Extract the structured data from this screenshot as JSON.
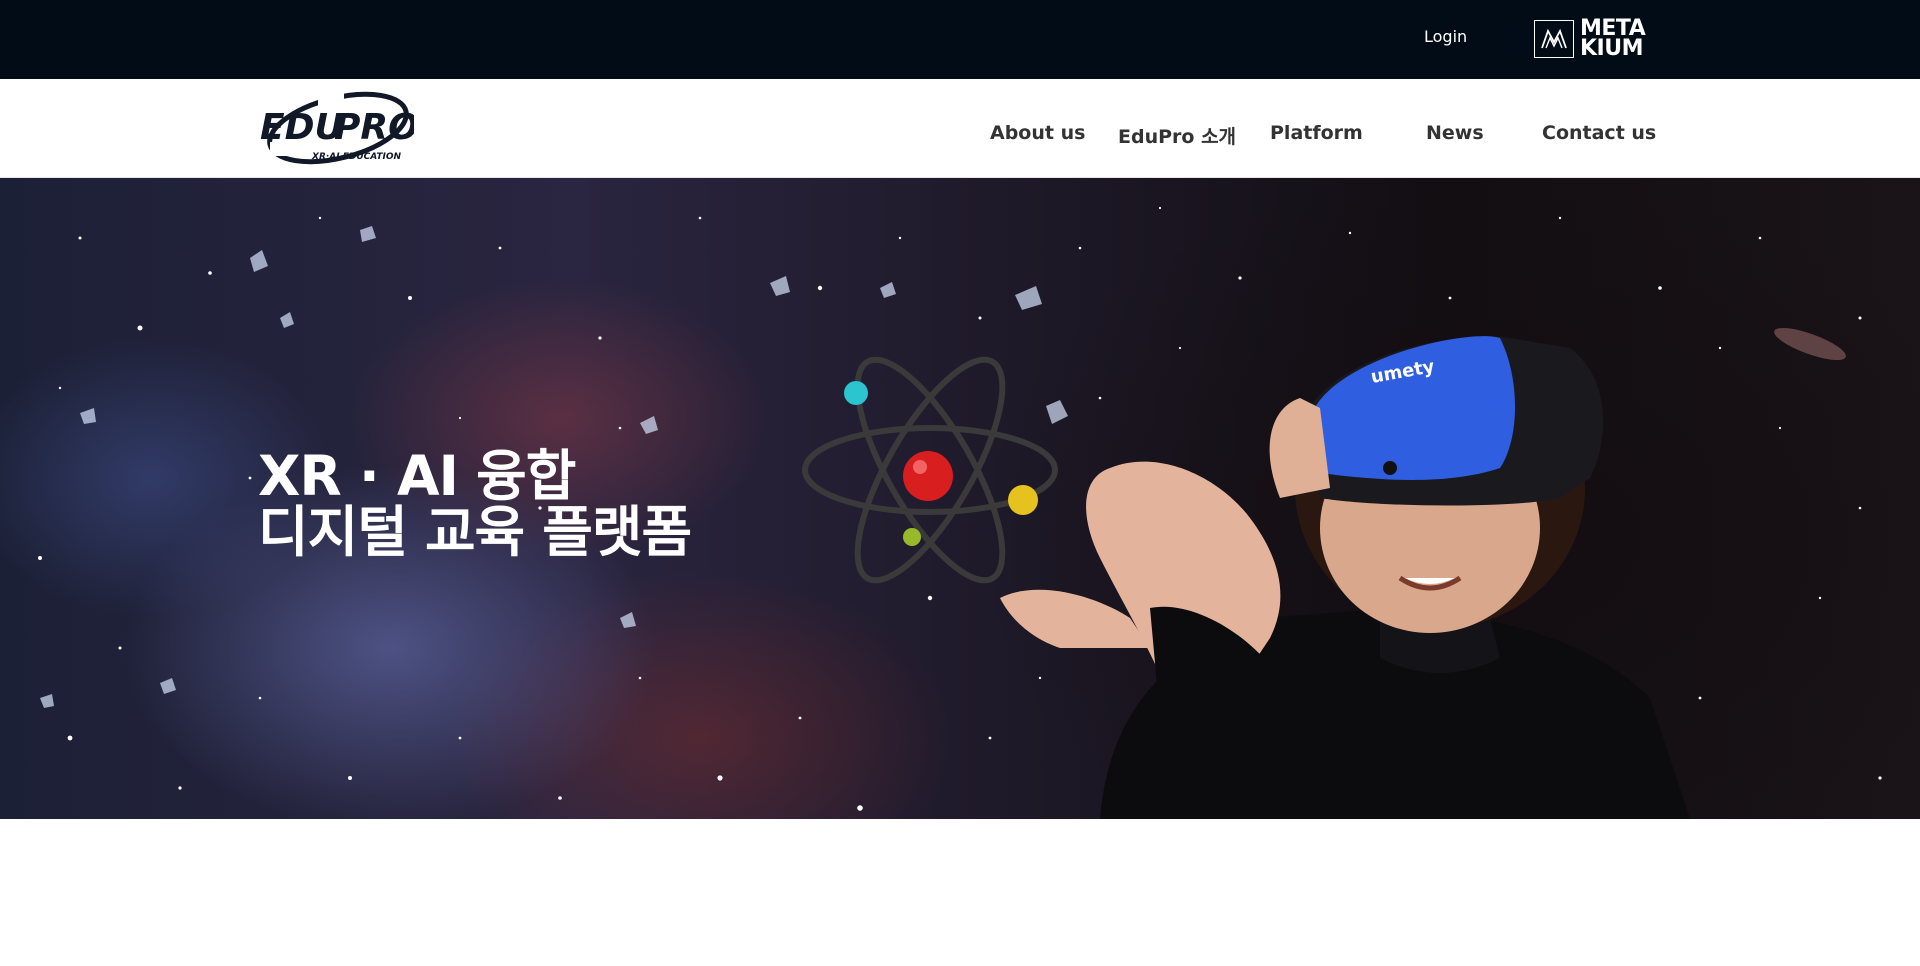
{
  "topbar": {
    "login_label": "Login",
    "partner_logo": {
      "line1": "META",
      "line2": "KIUM"
    }
  },
  "brand": {
    "logo_main_left": "EDU",
    "logo_main_right": "PRO",
    "logo_sub": "XR·AI EDUCATION"
  },
  "nav": {
    "items": [
      "About us",
      "EduPro 소개",
      "Platform",
      "News",
      "Contact us"
    ]
  },
  "hero": {
    "title_line1": "XR · AI 융합",
    "title_line2": "디지털 교육 플랫폼",
    "headset_brand": "umety"
  },
  "colors": {
    "topbar_bg": "#020c16",
    "nav_text": "#333333",
    "headset_blue": "#2f5fe0",
    "atom_nucleus": "#d81e1e"
  }
}
